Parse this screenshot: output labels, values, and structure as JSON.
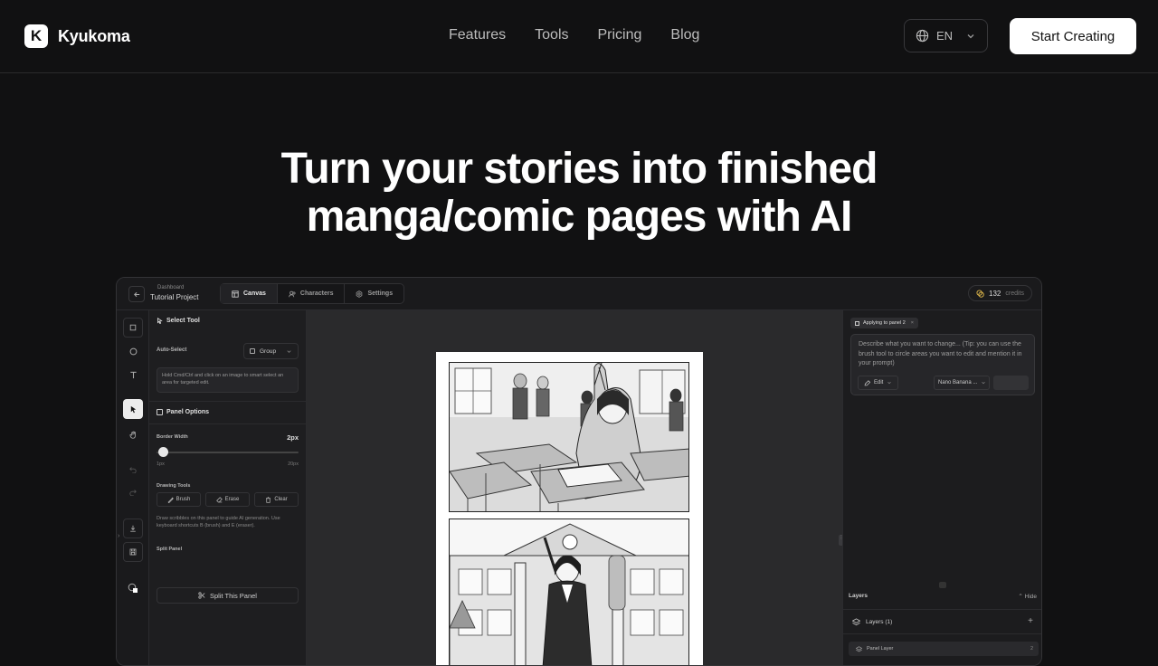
{
  "nav": {
    "brand": "Kyukoma",
    "brand_initial": "K",
    "links": [
      "Features",
      "Tools",
      "Pricing",
      "Blog"
    ],
    "language": "EN",
    "cta": "Start Creating"
  },
  "hero": {
    "line1": "Turn your stories into finished",
    "line2": "manga/comic pages with AI"
  },
  "app": {
    "breadcrumb_parent": "Dashboard",
    "breadcrumb_current": "Tutorial Project",
    "tabs": [
      "Canvas",
      "Characters",
      "Settings"
    ],
    "credits_value": "132",
    "credits_label": "credits",
    "left_panel": {
      "title": "Select Tool",
      "auto_select_label": "Auto-Select",
      "auto_select_value": "Group",
      "hint": "Hold Cmd/Ctrl and click on an image to smart select an area for targeted edit.",
      "panel_options": "Panel Options",
      "border_width_label": "Border Width",
      "border_width_value": "2px",
      "border_min": "1px",
      "border_max": "20px",
      "border_width_level": 0.05,
      "drawing_tools_label": "Drawing Tools",
      "tools": [
        "Brush",
        "Erase",
        "Clear"
      ],
      "drawing_hint": "Draw scribbles on this panel to guide AI generation. Use keyboard shortcuts B (brush) and E (eraser).",
      "split_label": "Split Panel",
      "split_button": "Split This Panel"
    },
    "right_panel": {
      "applying": "Applying to panel 2",
      "prompt_placeholder": "Describe what you want to change... (Tip: you can use the brush tool to circle areas you want to edit and mention it in your prompt)",
      "edit_label": "Edit",
      "model_label": "Nano Banana ...",
      "layers_label": "Layers",
      "hide_label": "Hide",
      "layers_count": "Layers (1)",
      "panel_layer": "Panel Layer",
      "panel_layer_num": "2"
    }
  }
}
